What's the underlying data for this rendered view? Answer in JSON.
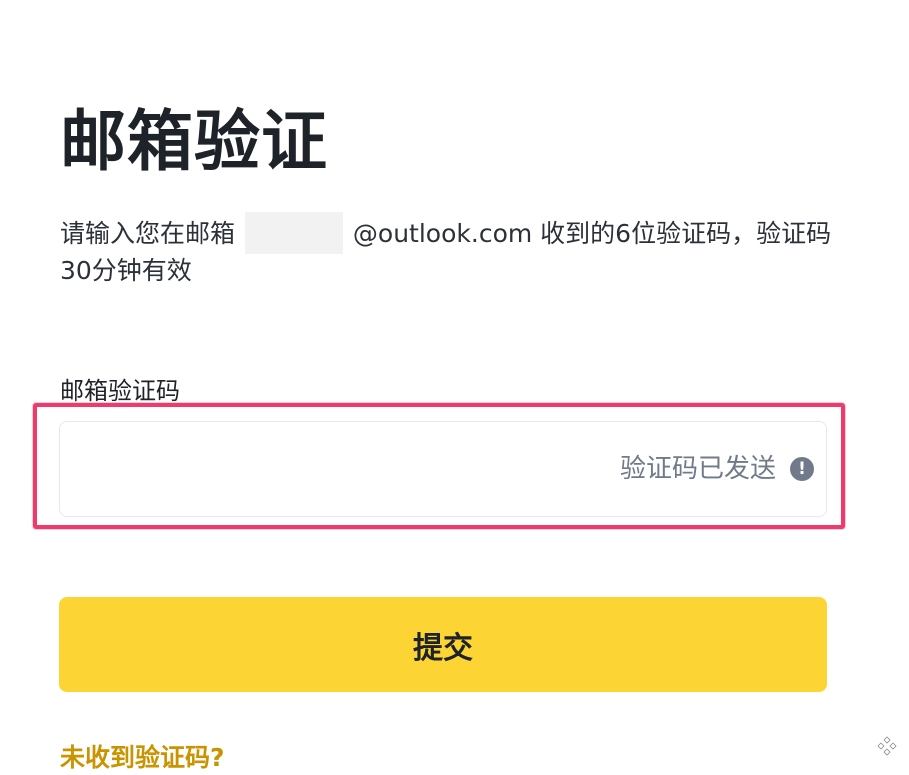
{
  "page": {
    "title": "邮箱验证"
  },
  "instructions": {
    "prefix": "请输入您在邮箱",
    "email_suffix": "@outlook.com",
    "suffix": " 收到的6位验证码，验证码30分钟有效"
  },
  "code_field": {
    "label": "邮箱验证码",
    "value": "",
    "status_text": "验证码已发送",
    "status_icon": "info-icon"
  },
  "actions": {
    "submit_label": "提交",
    "resend_link": "未收到验证码?"
  },
  "colors": {
    "primary_yellow": "#fcd535",
    "link_gold": "#c99400",
    "highlight_pink": "#ef3a6c",
    "muted_text": "#707a8a"
  }
}
